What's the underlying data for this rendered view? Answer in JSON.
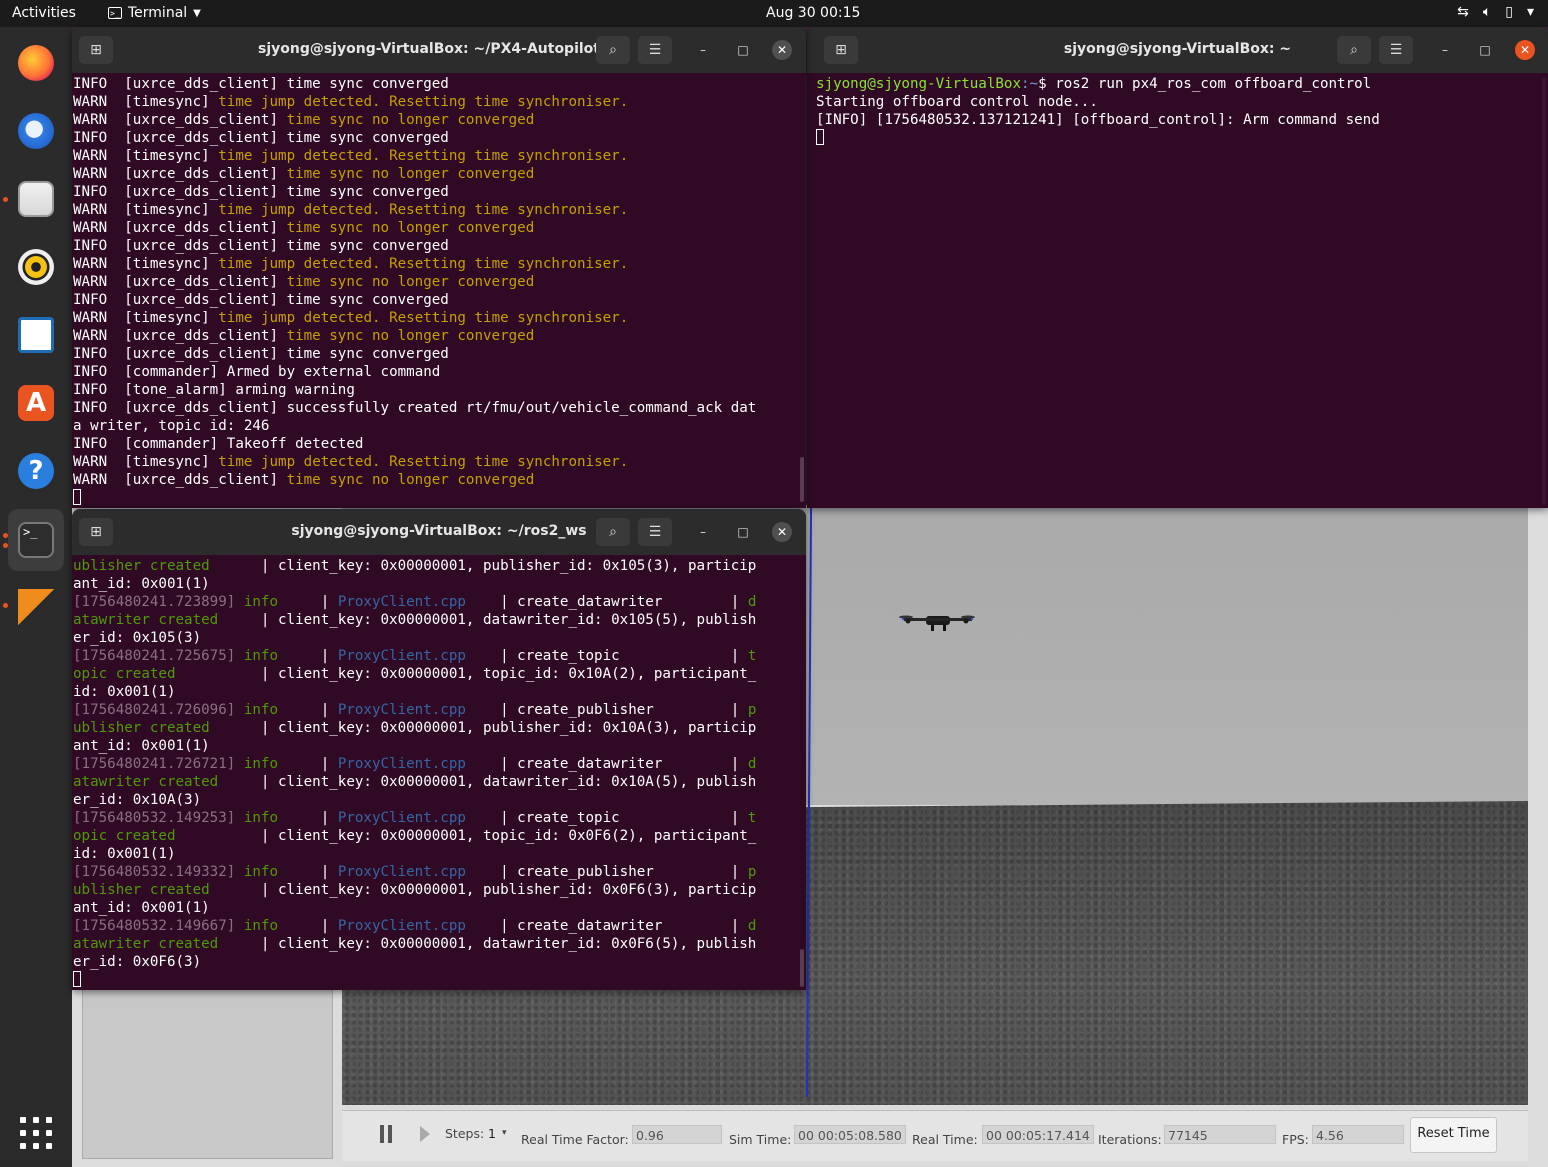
{
  "topbar": {
    "activities": "Activities",
    "app_name": "Terminal",
    "clock": "Aug 30  00:15",
    "tray_icons": [
      "network-icon",
      "volume-icon",
      "battery-icon",
      "power-menu-icon"
    ]
  },
  "dock": {
    "items": [
      "firefox",
      "thunderbird",
      "files",
      "rhythmbox",
      "libreoffice-writer",
      "ubuntu-software",
      "help",
      "terminal",
      "qgroundcontrol"
    ],
    "running": [
      "files",
      "terminal",
      "qgroundcontrol"
    ],
    "active": "terminal"
  },
  "term_px4": {
    "title": "sjyong@sjyong-VirtualBox: ~/PX4-Autopilot",
    "lines": [
      {
        "lvl": "INFO",
        "tag": "[uxrce_dds_client]",
        "msg": "time sync converged",
        "warn": false
      },
      {
        "lvl": "WARN",
        "tag": "[timesync]",
        "msg": "time jump detected. Resetting time synchroniser.",
        "warn": true
      },
      {
        "lvl": "WARN",
        "tag": "[uxrce_dds_client]",
        "msg": "time sync no longer converged",
        "warn": true
      },
      {
        "lvl": "INFO",
        "tag": "[uxrce_dds_client]",
        "msg": "time sync converged",
        "warn": false
      },
      {
        "lvl": "WARN",
        "tag": "[timesync]",
        "msg": "time jump detected. Resetting time synchroniser.",
        "warn": true
      },
      {
        "lvl": "WARN",
        "tag": "[uxrce_dds_client]",
        "msg": "time sync no longer converged",
        "warn": true
      },
      {
        "lvl": "INFO",
        "tag": "[uxrce_dds_client]",
        "msg": "time sync converged",
        "warn": false
      },
      {
        "lvl": "WARN",
        "tag": "[timesync]",
        "msg": "time jump detected. Resetting time synchroniser.",
        "warn": true
      },
      {
        "lvl": "WARN",
        "tag": "[uxrce_dds_client]",
        "msg": "time sync no longer converged",
        "warn": true
      },
      {
        "lvl": "INFO",
        "tag": "[uxrce_dds_client]",
        "msg": "time sync converged",
        "warn": false
      },
      {
        "lvl": "WARN",
        "tag": "[timesync]",
        "msg": "time jump detected. Resetting time synchroniser.",
        "warn": true
      },
      {
        "lvl": "WARN",
        "tag": "[uxrce_dds_client]",
        "msg": "time sync no longer converged",
        "warn": true
      },
      {
        "lvl": "INFO",
        "tag": "[uxrce_dds_client]",
        "msg": "time sync converged",
        "warn": false
      },
      {
        "lvl": "WARN",
        "tag": "[timesync]",
        "msg": "time jump detected. Resetting time synchroniser.",
        "warn": true
      },
      {
        "lvl": "WARN",
        "tag": "[uxrce_dds_client]",
        "msg": "time sync no longer converged",
        "warn": true
      },
      {
        "lvl": "INFO",
        "tag": "[uxrce_dds_client]",
        "msg": "time sync converged",
        "warn": false
      },
      {
        "lvl": "INFO",
        "tag": "[commander]",
        "msg": "Armed by external command",
        "warn": false
      },
      {
        "lvl": "INFO",
        "tag": "[tone_alarm]",
        "msg": "arming warning",
        "warn": false
      },
      {
        "lvl": "INFO",
        "tag": "[uxrce_dds_client]",
        "msg": "successfully created rt/fmu/out/vehicle_command_ack dat",
        "warn": false
      },
      {
        "raw": "a writer, topic id: 246"
      },
      {
        "lvl": "INFO",
        "tag": "[commander]",
        "msg": "Takeoff detected",
        "warn": false
      },
      {
        "lvl": "WARN",
        "tag": "[timesync]",
        "msg": "time jump detected. Resetting time synchroniser.",
        "warn": true
      },
      {
        "lvl": "WARN",
        "tag": "[uxrce_dds_client]",
        "msg": "time sync no longer converged",
        "warn": true
      }
    ]
  },
  "term_home": {
    "title": "sjyong@sjyong-VirtualBox: ~",
    "prompt_user": "sjyong@sjyong-VirtualBox",
    "prompt_path": ":~",
    "prompt_sym": "$ ",
    "command": "ros2 run px4_ros_com offboard_control",
    "output": [
      "Starting offboard control node...",
      "[INFO] [1756480532.137121241] [offboard_control]: Arm command send"
    ]
  },
  "term_ros2": {
    "title": "sjyong@sjyong-VirtualBox: ~/ros2_ws",
    "lines": [
      [
        {
          "t": "ublisher created",
          "c": "g"
        },
        {
          "t": "      | client_key: 0x00000001, publisher_id: 0x105(3), particip",
          "c": ""
        }
      ],
      [
        {
          "t": "ant_id: 0x001(1)",
          "c": ""
        }
      ],
      [
        {
          "t": "[1756480241.723899] ",
          "c": "gr"
        },
        {
          "t": "info",
          "c": "g"
        },
        {
          "t": "     | ",
          "c": ""
        },
        {
          "t": "ProxyClient.cpp",
          "c": "b"
        },
        {
          "t": "    | create_datawriter        | ",
          "c": ""
        },
        {
          "t": "d",
          "c": "g"
        }
      ],
      [
        {
          "t": "atawriter created",
          "c": "g"
        },
        {
          "t": "     | client_key: 0x00000001, datawriter_id: 0x105(5), publish",
          "c": ""
        }
      ],
      [
        {
          "t": "er_id: 0x105(3)",
          "c": ""
        }
      ],
      [
        {
          "t": "[1756480241.725675] ",
          "c": "gr"
        },
        {
          "t": "info",
          "c": "g"
        },
        {
          "t": "     | ",
          "c": ""
        },
        {
          "t": "ProxyClient.cpp",
          "c": "b"
        },
        {
          "t": "    | create_topic             | ",
          "c": ""
        },
        {
          "t": "t",
          "c": "g"
        }
      ],
      [
        {
          "t": "opic created",
          "c": "g"
        },
        {
          "t": "          | client_key: 0x00000001, topic_id: 0x10A(2), participant_",
          "c": ""
        }
      ],
      [
        {
          "t": "id: 0x001(1)",
          "c": ""
        }
      ],
      [
        {
          "t": "[1756480241.726096] ",
          "c": "gr"
        },
        {
          "t": "info",
          "c": "g"
        },
        {
          "t": "     | ",
          "c": ""
        },
        {
          "t": "ProxyClient.cpp",
          "c": "b"
        },
        {
          "t": "    | create_publisher         | ",
          "c": ""
        },
        {
          "t": "p",
          "c": "g"
        }
      ],
      [
        {
          "t": "ublisher created",
          "c": "g"
        },
        {
          "t": "      | client_key: 0x00000001, publisher_id: 0x10A(3), particip",
          "c": ""
        }
      ],
      [
        {
          "t": "ant_id: 0x001(1)",
          "c": ""
        }
      ],
      [
        {
          "t": "[1756480241.726721] ",
          "c": "gr"
        },
        {
          "t": "info",
          "c": "g"
        },
        {
          "t": "     | ",
          "c": ""
        },
        {
          "t": "ProxyClient.cpp",
          "c": "b"
        },
        {
          "t": "    | create_datawriter        | ",
          "c": ""
        },
        {
          "t": "d",
          "c": "g"
        }
      ],
      [
        {
          "t": "atawriter created",
          "c": "g"
        },
        {
          "t": "     | client_key: 0x00000001, datawriter_id: 0x10A(5), publish",
          "c": ""
        }
      ],
      [
        {
          "t": "er_id: 0x10A(3)",
          "c": ""
        }
      ],
      [
        {
          "t": "[1756480532.149253] ",
          "c": "gr"
        },
        {
          "t": "info",
          "c": "g"
        },
        {
          "t": "     | ",
          "c": ""
        },
        {
          "t": "ProxyClient.cpp",
          "c": "b"
        },
        {
          "t": "    | create_topic             | ",
          "c": ""
        },
        {
          "t": "t",
          "c": "g"
        }
      ],
      [
        {
          "t": "opic created",
          "c": "g"
        },
        {
          "t": "          | client_key: 0x00000001, topic_id: 0x0F6(2), participant_",
          "c": ""
        }
      ],
      [
        {
          "t": "id: 0x001(1)",
          "c": ""
        }
      ],
      [
        {
          "t": "[1756480532.149332] ",
          "c": "gr"
        },
        {
          "t": "info",
          "c": "g"
        },
        {
          "t": "     | ",
          "c": ""
        },
        {
          "t": "ProxyClient.cpp",
          "c": "b"
        },
        {
          "t": "    | create_publisher         | ",
          "c": ""
        },
        {
          "t": "p",
          "c": "g"
        }
      ],
      [
        {
          "t": "ublisher created",
          "c": "g"
        },
        {
          "t": "      | client_key: 0x00000001, publisher_id: 0x0F6(3), particip",
          "c": ""
        }
      ],
      [
        {
          "t": "ant_id: 0x001(1)",
          "c": ""
        }
      ],
      [
        {
          "t": "[1756480532.149667] ",
          "c": "gr"
        },
        {
          "t": "info",
          "c": "g"
        },
        {
          "t": "     | ",
          "c": ""
        },
        {
          "t": "ProxyClient.cpp",
          "c": "b"
        },
        {
          "t": "    | create_datawriter        | ",
          "c": ""
        },
        {
          "t": "d",
          "c": "g"
        }
      ],
      [
        {
          "t": "atawriter created",
          "c": "g"
        },
        {
          "t": "     | client_key: 0x00000001, datawriter_id: 0x0F6(5), publish",
          "c": ""
        }
      ],
      [
        {
          "t": "er_id: 0x0F6(3)",
          "c": ""
        }
      ]
    ]
  },
  "gazebo": {
    "steps_label": "Steps:",
    "steps_value": "1",
    "rtf_label": "Real Time Factor:",
    "rtf_value": "0.96",
    "sim_time_label": "Sim Time:",
    "sim_time_value": "00 00:05:08.580",
    "real_time_label": "Real Time:",
    "real_time_value": "00 00:05:17.414",
    "iterations_label": "Iterations:",
    "iterations_value": "77145",
    "fps_label": "FPS:",
    "fps_value": "4.56",
    "reset_label": "Reset Time"
  },
  "colors": {
    "terminal_bg": "#300a24",
    "accent": "#e95420",
    "warn": "#c4a000",
    "info_green": "#4e9a06",
    "link_blue": "#3465a4"
  }
}
